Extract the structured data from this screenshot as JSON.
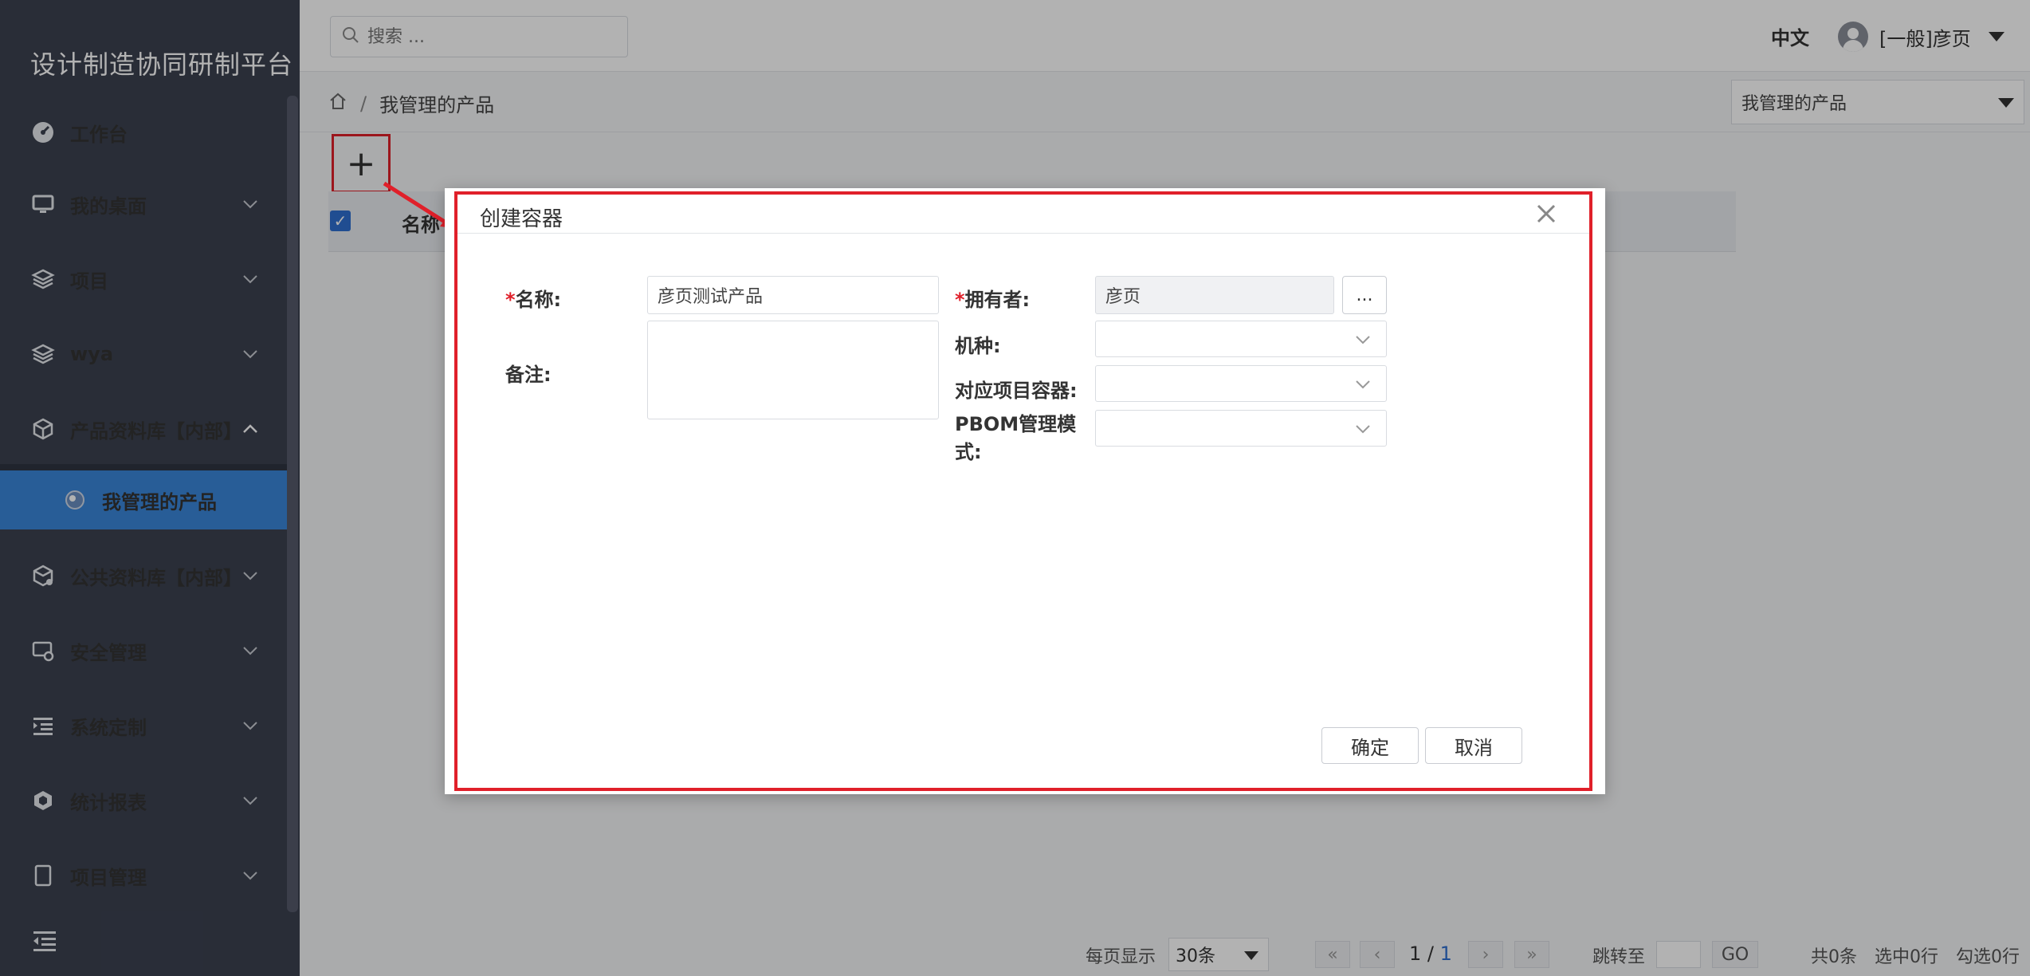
{
  "app": {
    "title": "设计制造协同研制平台"
  },
  "sidebar": {
    "items": [
      {
        "label": "工作台",
        "icon": "dashboard-icon"
      },
      {
        "label": "我的桌面",
        "icon": "monitor-icon"
      },
      {
        "label": "项目",
        "icon": "layers-icon"
      },
      {
        "label": "wya",
        "icon": "layers-icon"
      },
      {
        "label": "产品资料库【内部】",
        "icon": "cube-icon"
      },
      {
        "label": "公共资料库【内部】",
        "icon": "cube-share-icon"
      },
      {
        "label": "安全管理",
        "icon": "screen-gear-icon"
      },
      {
        "label": "系统定制",
        "icon": "list-indent-icon"
      },
      {
        "label": "统计报表",
        "icon": "hexagon-icon"
      },
      {
        "label": "项目管理",
        "icon": "document-icon"
      }
    ],
    "active_sub": {
      "label": "我管理的产品",
      "icon": "globe-icon"
    }
  },
  "topbar": {
    "search_placeholder": "搜索 ...",
    "language": "中文",
    "user": "[一般]彦页"
  },
  "breadcrumb": {
    "current": "我管理的产品",
    "separator": "/"
  },
  "view_select": {
    "value": "我管理的产品"
  },
  "toolbar": {
    "add_label": "+"
  },
  "table": {
    "columns": [
      "名称"
    ]
  },
  "dialog": {
    "title": "创建容器",
    "fields": {
      "name_label": "名称:",
      "name_value": "彦页测试产品",
      "remark_label": "备注:",
      "owner_label": "拥有者:",
      "owner_value": "彦页",
      "owner_picker": "...",
      "model_label": "机种:",
      "project_container_label": "对应项目容器:",
      "pbom_label_line1": "PBOM管理模",
      "pbom_label_line2": "式:",
      "required_mark": "*"
    },
    "ok_label": "确定",
    "cancel_label": "取消"
  },
  "pagination": {
    "per_page_label": "每页显示",
    "per_page_value": "30条",
    "current_page": "1",
    "page_sep": " / ",
    "total_pages": "1",
    "jump_label": "跳转至",
    "go_label": "GO",
    "total": "共0条",
    "selected": "选中0行",
    "checked": "勾选0行"
  },
  "colors": {
    "sidebar_bg": "#3b4150",
    "active_blue": "#3a86d9",
    "highlight_red": "#e0202a",
    "checkbox_blue": "#2f6fd0"
  }
}
